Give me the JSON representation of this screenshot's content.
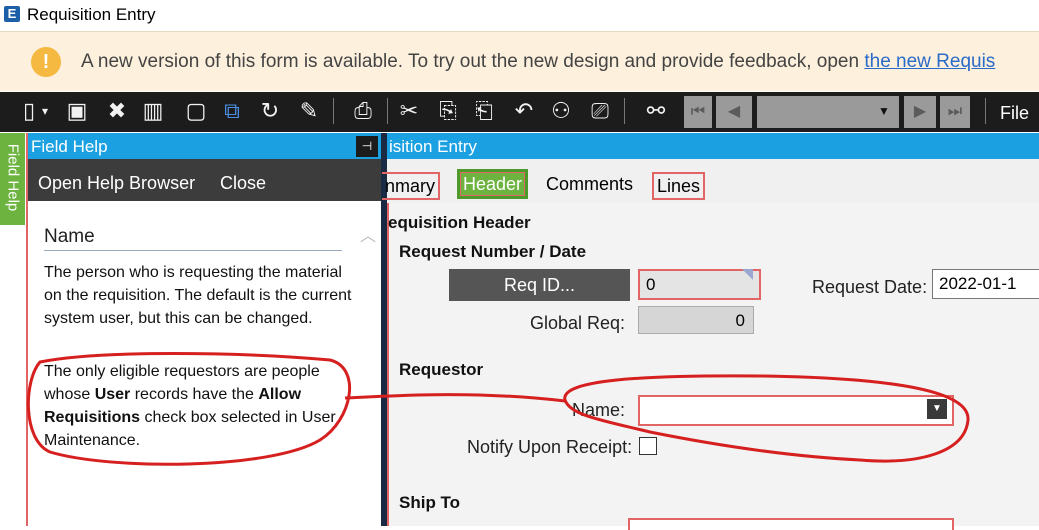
{
  "window": {
    "title": "Requisition Entry",
    "logo": "E"
  },
  "notification": {
    "icon": "warning-icon",
    "icon_glyph": "!",
    "text": "A new version of this form is available. To try out the new design and provide feedback, open ",
    "link": "the new Requis"
  },
  "toolbar": {
    "icons": [
      "new-icon",
      "dropdown-arrow-icon",
      "save-icon",
      "delete-icon",
      "library-icon",
      "notes-icon",
      "copy-icon",
      "refresh-icon",
      "clear-icon",
      "print-icon",
      "cut-icon",
      "copy-icon",
      "paste-icon",
      "undo-icon",
      "hierarchy-icon",
      "clipboard-icon",
      "binoculars-icon"
    ],
    "file_label": "File"
  },
  "side_tab": {
    "label": "Field Help"
  },
  "field_help": {
    "title": "Field Help",
    "pin_glyph": "⊣",
    "open_help_browser": "Open Help Browser",
    "close": "Close",
    "heading": "Name",
    "paragraph1": "The person who is requesting the material on the requisition. The default is the current system user, but this can be changed.",
    "paragraph2": {
      "part1": "The only eligible requestors are people whose ",
      "bold1": "User",
      "part2": " records have the ",
      "bold2": "Allow Requisitions",
      "part3": " check box selected in User Maintenance."
    }
  },
  "form": {
    "title": "isition Entry",
    "tabs": [
      {
        "label": "nmary"
      },
      {
        "label": "Header"
      },
      {
        "label": "Comments"
      },
      {
        "label": "Lines"
      }
    ],
    "sections": {
      "header": "equisition Header",
      "request_number": "Request Number / Date",
      "requestor": "Requestor",
      "ship_to": "Ship To"
    },
    "req_id_button": "Req ID...",
    "req_id_value": "0",
    "request_date_label": "Request Date:",
    "request_date_value": "2022-01-1",
    "global_req_label": "Global Req:",
    "global_req_value": "0",
    "name_label": "Name:",
    "name_value": "",
    "notify_label": "Notify Upon Receipt:"
  },
  "colors": {
    "accent_blue": "#1ba1e2",
    "accent_green": "#6db33f",
    "highlight_red": "#e26565",
    "annotation_red": "#d62020"
  }
}
